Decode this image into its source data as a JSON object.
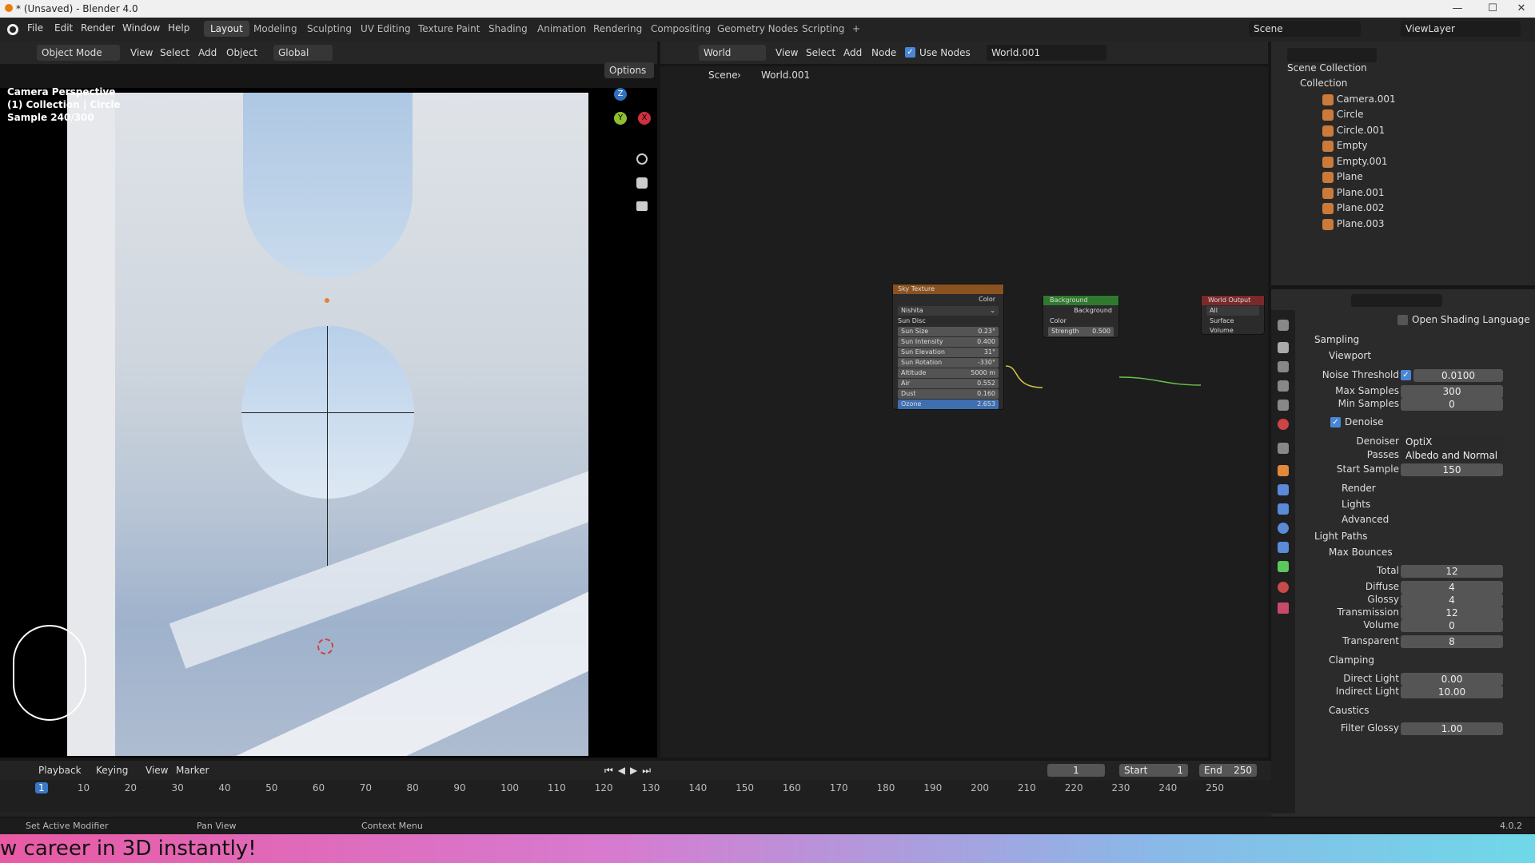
{
  "window": {
    "title": "* (Unsaved) - Blender 4.0",
    "minimize": "—",
    "maximize": "☐",
    "close": "✕"
  },
  "menus": [
    "File",
    "Edit",
    "Render",
    "Window",
    "Help"
  ],
  "workspaces": [
    "Layout",
    "Modeling",
    "Sculpting",
    "UV Editing",
    "Texture Paint",
    "Shading",
    "Animation",
    "Rendering",
    "Compositing",
    "Geometry Nodes",
    "Scripting",
    "+"
  ],
  "active_workspace": "Layout",
  "scene": {
    "name": "Scene",
    "viewlayer": "ViewLayer"
  },
  "viewport_header": {
    "mode": "Object Mode",
    "view": "View",
    "select": "Select",
    "add": "Add",
    "object": "Object",
    "orientation": "Global",
    "options": "Options"
  },
  "viewport_overlay": {
    "line1": "Camera Perspective",
    "line2": "(1) Collection | Circle",
    "line3": "Sample 240/300"
  },
  "gizmo": {
    "z": "Z",
    "y": "Y",
    "x": "X"
  },
  "node_header": {
    "type": "World",
    "view": "View",
    "select": "Select",
    "add": "Add",
    "node": "Node",
    "use_nodes": "Use Nodes",
    "world": "World.001"
  },
  "breadcrumb": {
    "scene": "Scene",
    "world": "World.001"
  },
  "sky_node": {
    "title": "Sky Texture",
    "out": "Color",
    "type": "Nishita",
    "sun_disc": "Sun Disc",
    "rows": [
      {
        "l": "Sun Size",
        "v": "0.23°"
      },
      {
        "l": "Sun Intensity",
        "v": "0.400"
      },
      {
        "l": "Sun Elevation",
        "v": "31°"
      },
      {
        "l": "Sun Rotation",
        "v": "-330°"
      },
      {
        "l": "Altitude",
        "v": "5000 m"
      },
      {
        "l": "Air",
        "v": "0.552"
      },
      {
        "l": "Dust",
        "v": "0.160"
      },
      {
        "l": "Ozone",
        "v": "2.653"
      }
    ]
  },
  "bg_node": {
    "title": "Background",
    "out": "Background",
    "color": "Color",
    "strength_l": "Strength",
    "strength_v": "0.500"
  },
  "out_node": {
    "title": "World Output",
    "target": "All",
    "surface": "Surface",
    "volume": "Volume"
  },
  "outliner": {
    "root": "Scene Collection",
    "collection": "Collection",
    "items": [
      "Camera.001",
      "Circle",
      "Circle.001",
      "Empty",
      "Empty.001",
      "Plane",
      "Plane.001",
      "Plane.002",
      "Plane.003"
    ]
  },
  "props": {
    "osl": "Open Shading Language",
    "sampling": "Sampling",
    "viewport": "Viewport",
    "noise_threshold_l": "Noise Threshold",
    "noise_threshold_v": "0.0100",
    "max_samples_l": "Max Samples",
    "max_samples_v": "300",
    "min_samples_l": "Min Samples",
    "min_samples_v": "0",
    "denoise": "Denoise",
    "denoiser_l": "Denoiser",
    "denoiser_v": "OptiX",
    "passes_l": "Passes",
    "passes_v": "Albedo and Normal",
    "start_sample_l": "Start Sample",
    "start_sample_v": "150",
    "render": "Render",
    "lights": "Lights",
    "advanced": "Advanced",
    "light_paths": "Light Paths",
    "max_bounces": "Max Bounces",
    "total_l": "Total",
    "total_v": "12",
    "diffuse_l": "Diffuse",
    "diffuse_v": "4",
    "glossy_l": "Glossy",
    "glossy_v": "4",
    "transmission_l": "Transmission",
    "transmission_v": "12",
    "volume_l": "Volume",
    "volume_v": "0",
    "transparent_l": "Transparent",
    "transparent_v": "8",
    "clamping": "Clamping",
    "direct_l": "Direct Light",
    "direct_v": "0.00",
    "indirect_l": "Indirect Light",
    "indirect_v": "10.00",
    "caustics": "Caustics",
    "filter_glossy_l": "Filter Glossy",
    "filter_glossy_v": "1.00"
  },
  "timeline": {
    "playback": "Playback",
    "keying": "Keying",
    "view": "View",
    "marker": "Marker",
    "current": "1",
    "start_l": "Start",
    "start_v": "1",
    "end_l": "End",
    "end_v": "250",
    "ticks": [
      "1",
      "10",
      "20",
      "30",
      "40",
      "50",
      "60",
      "70",
      "80",
      "90",
      "100",
      "110",
      "120",
      "130",
      "140",
      "150",
      "160",
      "170",
      "180",
      "190",
      "200",
      "210",
      "220",
      "230",
      "240",
      "250"
    ]
  },
  "status": {
    "a": "Set Active Modifier",
    "b": "Pan View",
    "c": "Context Menu",
    "version": "4.0.2"
  },
  "banner": "w career in 3D instantly!"
}
